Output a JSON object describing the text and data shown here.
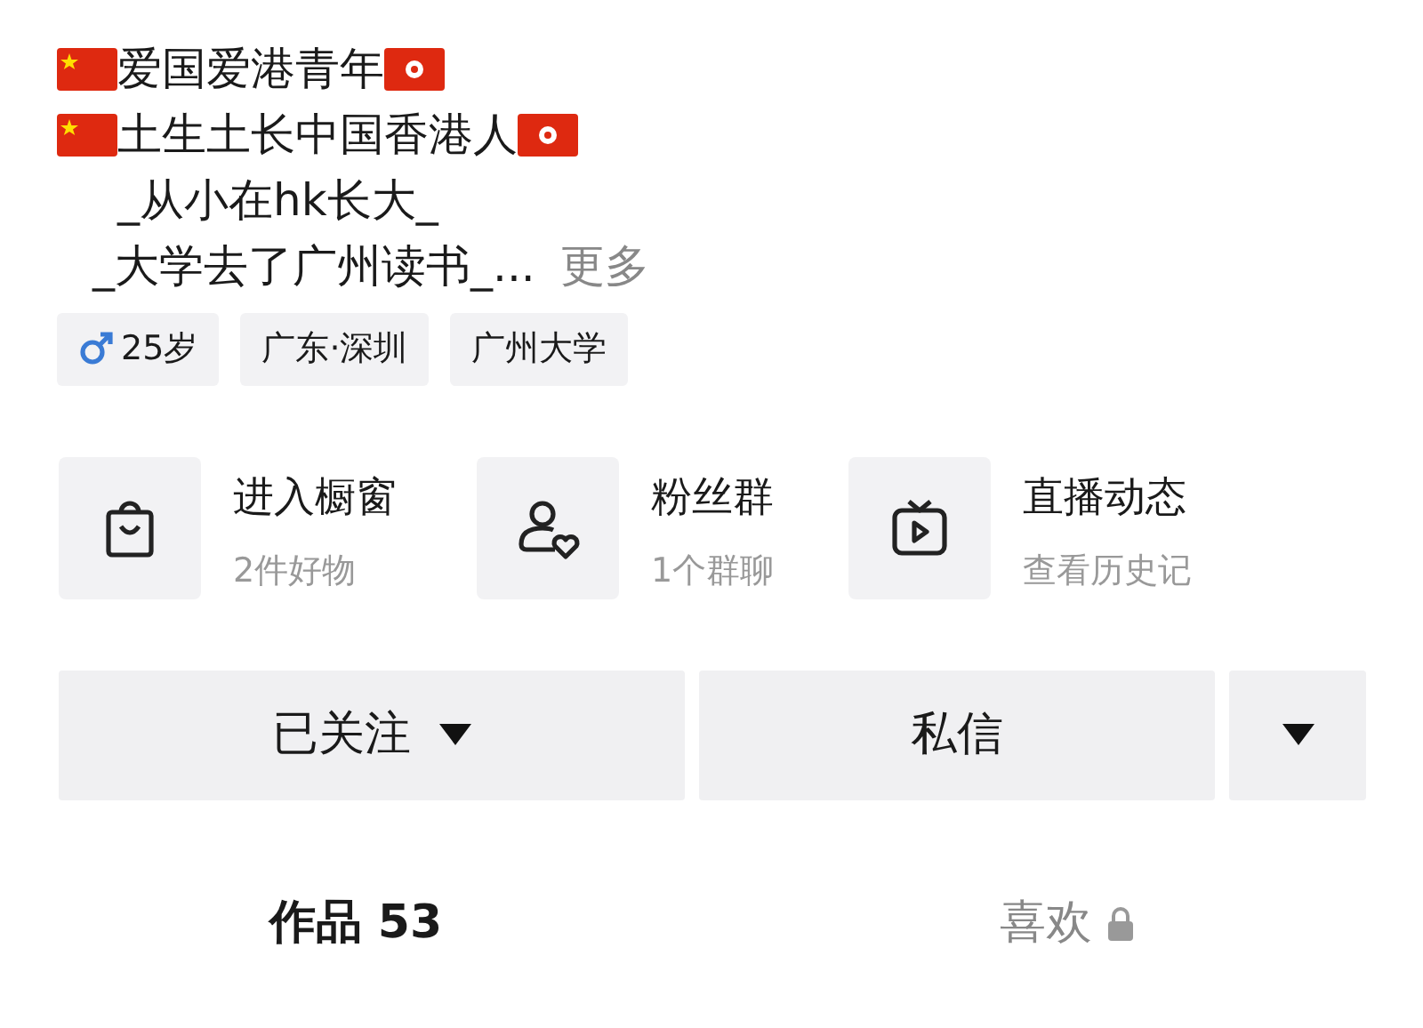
{
  "bio": {
    "lines": [
      {
        "text": "爱国爱港青年",
        "flags": true
      },
      {
        "text": "土生土长中国香港人",
        "flags": true
      },
      {
        "text": "_从小在hk长大_"
      },
      {
        "text": "_大学去了广州读书_...",
        "more": "更多"
      }
    ]
  },
  "tags": [
    {
      "kind": "gender",
      "text": "25岁"
    },
    {
      "kind": "plain",
      "text": "广东·深圳"
    },
    {
      "kind": "plain",
      "text": "广州大学"
    }
  ],
  "shortcuts": [
    {
      "kind": "shop",
      "title": "进入橱窗",
      "subtitle": "2件好物"
    },
    {
      "kind": "fans",
      "title": "粉丝群",
      "subtitle": "1个群聊"
    },
    {
      "kind": "live",
      "title": "直播动态",
      "subtitle": "查看历史记"
    }
  ],
  "buttons": [
    {
      "kind": "follow",
      "label": "已关注"
    },
    {
      "kind": "message",
      "label": "私信"
    },
    {
      "kind": "more"
    }
  ],
  "tabs": [
    {
      "label": "作品 53",
      "selected": true,
      "locked": false
    },
    {
      "label": "喜欢",
      "selected": false,
      "locked": true
    }
  ]
}
